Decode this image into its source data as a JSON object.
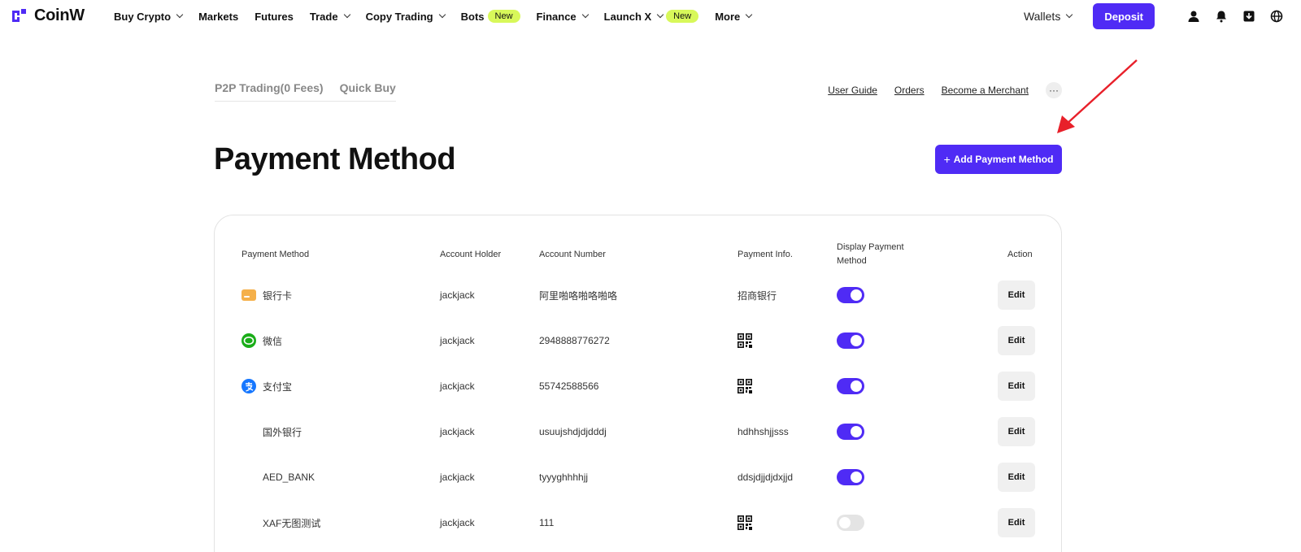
{
  "brand": {
    "name": "CoinW",
    "accent": "#4f2bf5"
  },
  "nav": {
    "items": [
      {
        "label": "Buy Crypto",
        "dropdown": true,
        "badge": ""
      },
      {
        "label": "Markets",
        "dropdown": false,
        "badge": ""
      },
      {
        "label": "Futures",
        "dropdown": false,
        "badge": ""
      },
      {
        "label": "Trade",
        "dropdown": true,
        "badge": ""
      },
      {
        "label": "Copy Trading",
        "dropdown": true,
        "badge": ""
      },
      {
        "label": "Bots",
        "dropdown": false,
        "badge": "New"
      },
      {
        "label": "Finance",
        "dropdown": true,
        "badge": ""
      },
      {
        "label": "Launch X",
        "dropdown": true,
        "badge": "New"
      },
      {
        "label": "More",
        "dropdown": true,
        "badge": ""
      }
    ],
    "wallets_label": "Wallets",
    "deposit_label": "Deposit",
    "icons": [
      "user-icon",
      "bell-icon",
      "download-icon",
      "globe-icon"
    ]
  },
  "subnav": {
    "tabs": [
      "P2P Trading(0 Fees)",
      "Quick Buy"
    ],
    "links": [
      "User Guide",
      "Orders",
      "Become a Merchant"
    ],
    "more_label": "···"
  },
  "page": {
    "title": "Payment Method",
    "add_button": {
      "plus": "+",
      "label": "Add Payment Method"
    }
  },
  "table": {
    "headers": {
      "method": "Payment Method",
      "holder": "Account Holder",
      "number": "Account Number",
      "info": "Payment Info.",
      "display": "Display Payment Method",
      "action": "Action"
    },
    "rows": [
      {
        "method": "银行卡",
        "icon": "bank-card-icon",
        "holder": "jackjack",
        "number": "阿里啪咯啪咯啪咯",
        "info": "招商银行",
        "info_type": "text",
        "display": true,
        "action": "Edit"
      },
      {
        "method": "微信",
        "icon": "wechat-icon",
        "holder": "jackjack",
        "number": "2948888776272",
        "info": "",
        "info_type": "qr",
        "display": true,
        "action": "Edit"
      },
      {
        "method": "支付宝",
        "icon": "alipay-icon",
        "holder": "jackjack",
        "number": "55742588566",
        "info": "",
        "info_type": "qr",
        "display": true,
        "action": "Edit"
      },
      {
        "method": "国外银行",
        "icon": "",
        "holder": "jackjack",
        "number": "usuujshdjdjdddj",
        "info": "hdhhshjjsss",
        "info_type": "text",
        "display": true,
        "action": "Edit"
      },
      {
        "method": "AED_BANK",
        "icon": "",
        "holder": "jackjack",
        "number": "tyyyghhhhjj",
        "info": "ddsjdjjdjdxjjd",
        "info_type": "text",
        "display": true,
        "action": "Edit"
      },
      {
        "method": "XAF无图测试",
        "icon": "",
        "holder": "jackjack",
        "number": "111",
        "info": "",
        "info_type": "qr",
        "display": false,
        "action": "Edit"
      }
    ]
  }
}
